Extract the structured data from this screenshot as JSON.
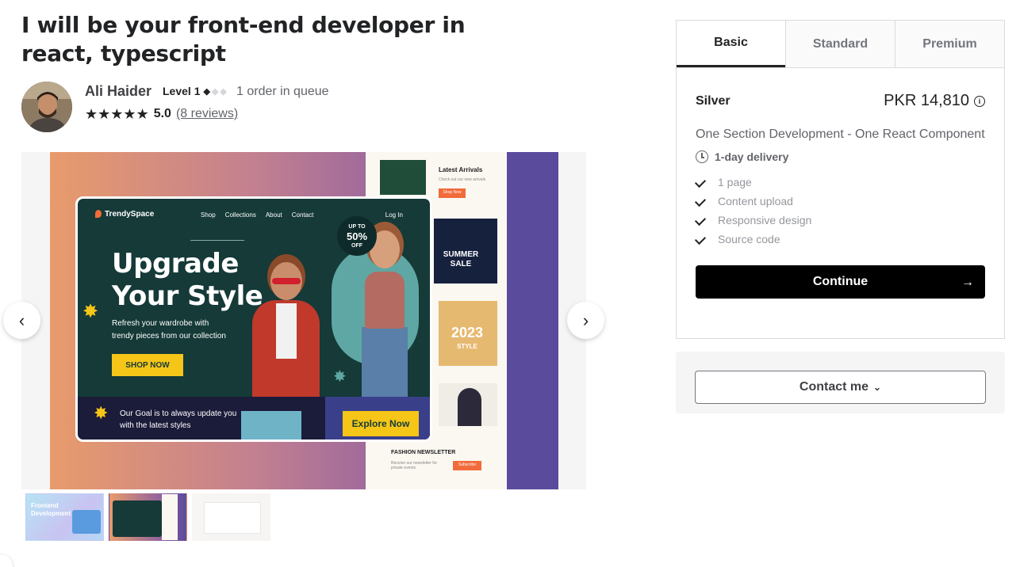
{
  "gig": {
    "title": "I will be your front-end developer in react, typescript"
  },
  "seller": {
    "name": "Ali Haider",
    "level": "Level 1",
    "queue": "1 order in queue",
    "rating": "5.0",
    "reviews": "(8 reviews)",
    "stars": "★★★★★"
  },
  "gallery": {
    "prev_icon": "‹",
    "next_icon": "›",
    "mockup": {
      "brand": "TrendySpace",
      "nav": [
        "Shop",
        "Collections",
        "About",
        "Contact"
      ],
      "login": "Log In",
      "headline_1": "Upgrade",
      "headline_2": "Your Style",
      "subtext": "Refresh your wardrobe with trendy pieces from our collection",
      "shop_now": "SHOP NOW",
      "badge_top": "UP TO",
      "badge_value": "50%",
      "badge_bottom": "OFF",
      "goal_text": "Our Goal is to always update you with the latest styles",
      "explore": "Explore Now"
    },
    "side": {
      "latest": "Latest Arrivals",
      "latest_sub": "Check out our new arrivals",
      "shop_now_small": "Shop Now",
      "summer": "SUMMER SALE",
      "year": "2023",
      "style": "STYLE",
      "newsletter": "FASHION NEWSLETTER",
      "newsletter_sub": "Receive our newsletter for private events",
      "subscribe": "Subscribe"
    },
    "thumbnail_1_text": "Frontend Development"
  },
  "package": {
    "tabs": [
      "Basic",
      "Standard",
      "Premium"
    ],
    "active_tab": "Basic",
    "name": "Silver",
    "price": "PKR 14,810",
    "description": "One Section Development - One React Component",
    "delivery": "1-day delivery",
    "features": [
      "1 page",
      "Content upload",
      "Responsive design",
      "Source code"
    ],
    "continue_label": "Continue",
    "arrow": "→",
    "contact_label": "Contact me",
    "chevron": "⌄"
  },
  "colors": {
    "primary_button": "#000000",
    "text": "#222325",
    "muted": "#62646a"
  }
}
